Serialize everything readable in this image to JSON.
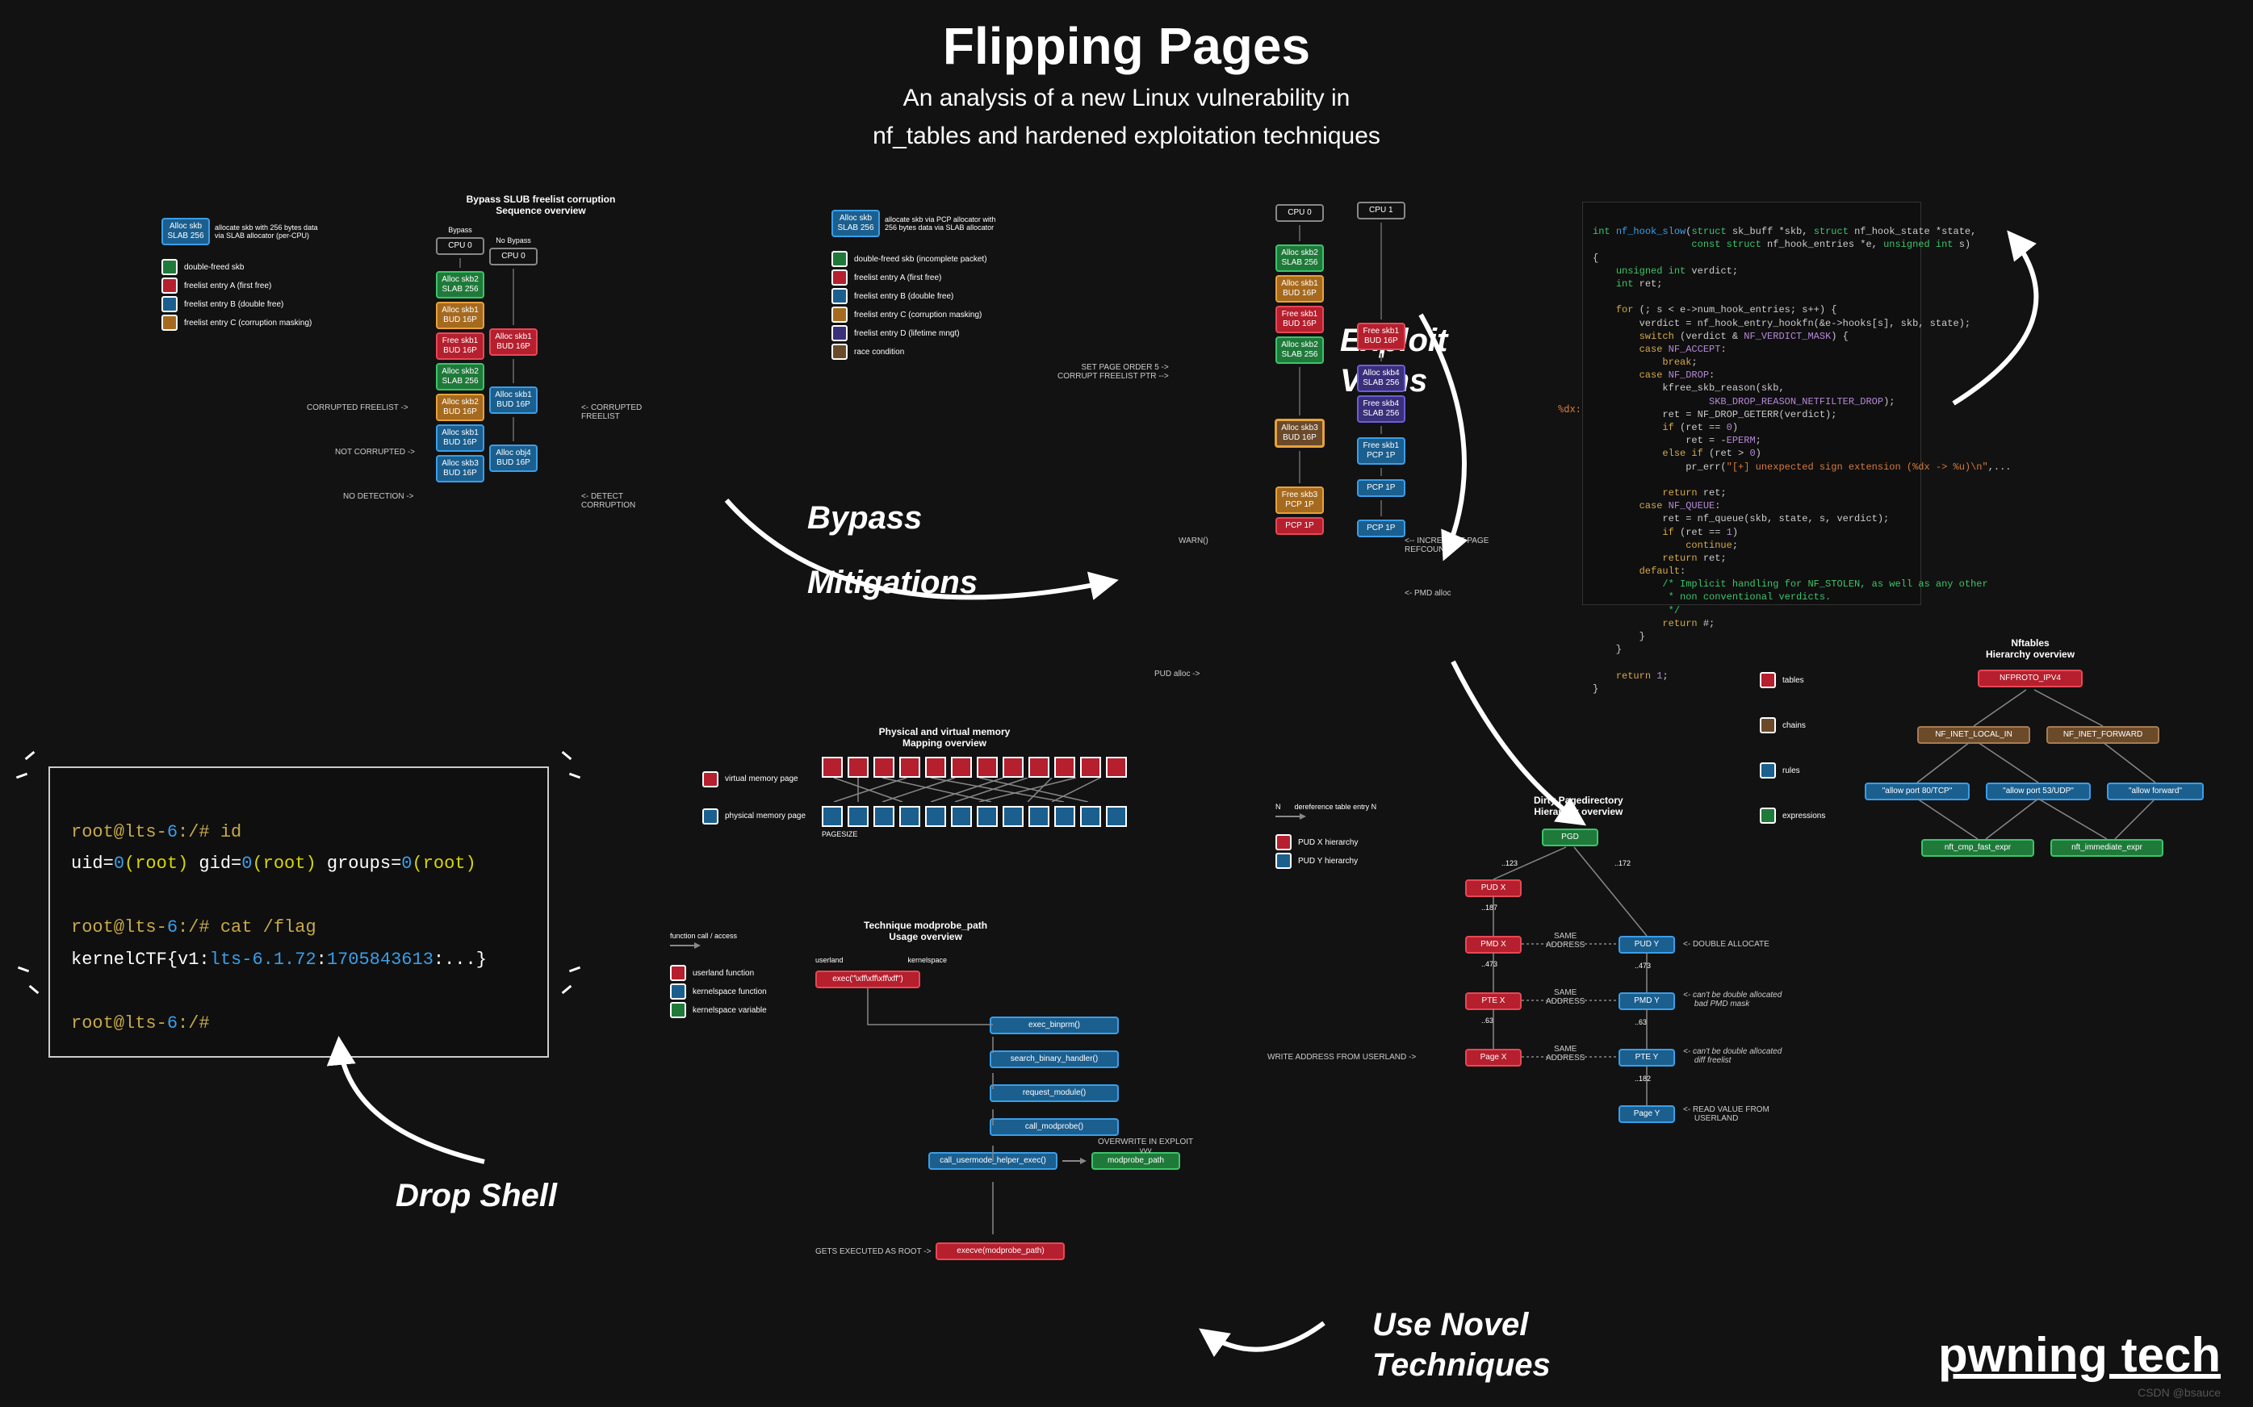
{
  "header": {
    "title": "Flipping Pages",
    "subtitle1": "An analysis of a new Linux vulnerability in",
    "subtitle2": "nf_tables and hardened exploitation techniques"
  },
  "brand": "pwning tech",
  "watermark": "CSDN @bsauce",
  "labels": {
    "bypass": "Bypass",
    "mitigations": "Mitigations",
    "exploit": "Exploit",
    "vulns": "Vulns",
    "use_novel": "Use Novel",
    "techniques": "Techniques",
    "drop_shell": "Drop Shell"
  },
  "terminal": {
    "l1a": "root@lts-",
    "l1b": "6",
    "l1c": ":/# id",
    "l2a": "uid=",
    "l2b": "0",
    "l2c": "(root)",
    "l2d": " gid=",
    "l2e": "0",
    "l2f": "(root)",
    "l2g": " groups=",
    "l2h": "0",
    "l2i": "(root)",
    "l3a": "root@lts-",
    "l3b": "6",
    "l3c": ":/# cat /flag",
    "l4a": "kernelCTF{v1:",
    "l4b": "lts-6.1.72",
    "l4c": ":",
    "l4d": "1705843613",
    "l4e": ":...}",
    "l5a": "root@lts-",
    "l5b": "6",
    "l5c": ":/#"
  },
  "panel1": {
    "title": "Bypass SLUB freelist corruption\nSequence overview",
    "alloc_box": "Alloc skb\nSLAB 256",
    "alloc_desc": "allocate skb with 256 bytes data\nvia SLAB allocator (per-CPU)",
    "leg_green": "double-freed skb",
    "leg_red": "freelist entry A  (first free)",
    "leg_blue": "freelist entry B (double free)",
    "leg_orange": "freelist entry C (corruption masking)",
    "hdr_bypass": "Bypass",
    "hdr_nobypass": "No Bypass",
    "cpu0": "CPU 0",
    "b1": "Alloc skb2\nSLAB 256",
    "b2": "Alloc skb1\nBUD 16P",
    "b3": "Free skb1\nBUD 16P",
    "b4": "Alloc skb2\nSLAB 256",
    "b5": "Alloc skb2\nBUD 16P",
    "b6": "Alloc skb1\nBUD 16P",
    "b7": "Alloc skb3\nBUD 16P",
    "n1": "Alloc skb1\nBUD 16P",
    "n2": "Alloc skb1\nBUD 16P",
    "n3": "Alloc obj4\nBUD 16P",
    "a1": "CORRUPTED FREELIST ->",
    "a2": "<- CORRUPTED FREELIST",
    "a3": "NOT CORRUPTED ->",
    "a4": "NO DETECTION ->",
    "a5": "<- DETECT CORRUPTION"
  },
  "panel2": {
    "alloc_box": "Alloc skb\nSLAB 256",
    "alloc_desc": "allocate skb via PCP allocator with\n256 bytes data via SLAB allocator",
    "leg_green": "double-freed skb (incomplete packet)",
    "leg_red": "freelist entry A  (first free)",
    "leg_blue": "freelist entry B (double free)",
    "leg_orange": "freelist entry C (corruption masking)",
    "leg_purple": "freelist entry D (lifetime mngt)",
    "leg_brown": "race condition"
  },
  "panel3": {
    "cpu0": "CPU 0",
    "cpu1": "CPU 1",
    "b1": "Alloc skb2\nSLAB 256",
    "b2": "Alloc skb1\nBUD 16P",
    "b3": "Free skb1\nBUD 16P",
    "c1": "Free skb1\nBUD 16P",
    "c2": "Alloc skb2\nSLAB 256",
    "d1": "Alloc skb4\nSLAB 256",
    "d2": "Free skb4\nSLAB 256",
    "e1": "Alloc skb3\nBUD 16P",
    "e2": "Free skb1\nPCP 1P",
    "f1": "Free skb3\nPCP 1P",
    "p1": "PCP 1P",
    "p2": "PCP 1P",
    "a1": "SET PAGE ORDER 5 ->\nCORRUPT FREELIST PTR -->",
    "a2": "WARN()",
    "a3": "<-- INCREMENT PAGE REFCOUNT",
    "a4": "<- PMD alloc",
    "a5": "PUD alloc ->"
  },
  "mapping": {
    "title1": "Physical and virtual memory",
    "title2": "Mapping overview",
    "leg_red": "virtual memory page",
    "leg_blue": "physical memory page",
    "pagesize": "PAGESIZE"
  },
  "modprobe": {
    "title1": "Technique modprobe_path",
    "title2": "Usage overview",
    "leg_title": "function call / access",
    "leg_red": "userland function",
    "leg_blue": "kernelspace function",
    "leg_green": "kernelspace variable",
    "col_user": "userland",
    "col_kernel": "kernelspace",
    "n_exec": "exec(\"\\xff\\xff\\xff\\xff\")",
    "n1": "exec_binprm()",
    "n2": "search_binary_handler()",
    "n3": "request_module()",
    "n4": "call_modprobe()",
    "n5": "call_usermode_helper_exec()",
    "n_var": "modprobe_path",
    "n_root": "execve(modprobe_path)",
    "a_over": "OVERWRITE IN EXPLOIT\nvvv",
    "a_root": "GETS EXECUTED AS ROOT ->"
  },
  "dirty": {
    "title1": "Dirty Pagedirectory",
    "title2": "Hierarchy overview",
    "leg_title": "dereference table entry N",
    "leg_n": "N",
    "leg_red": "PUD X hierarchy",
    "leg_blue": "PUD Y hierarchy",
    "pgd": "PGD",
    "pudx": "PUD X",
    "pudy": "PUD Y",
    "pmdx": "PMD X",
    "pmdy": "PMD Y",
    "ptex": "PTE X",
    "ptey": "PTE Y",
    "pagex": "Page X",
    "pagey": "Page Y",
    "e123": "..123",
    "e172": "..172",
    "e187": "..187",
    "e473a": "..473",
    "e473b": "..473",
    "e63a": "..63",
    "e63b": "..63",
    "e182": "..182",
    "same": "SAME\nADDRESS",
    "a1": "<- DOUBLE ALLOCATE",
    "a2": "<- can't be double allocated\n     bad PMD mask",
    "a3": "<- can't be double allocated\n     diff freelist",
    "a4": "WRITE ADDRESS FROM USERLAND ->",
    "a5": "<- READ VALUE FROM\n     USERLAND"
  },
  "nft": {
    "title1": "Nftables",
    "title2": "Hierarchy overview",
    "leg_red": "tables",
    "leg_brown": "chains",
    "leg_blue": "rules",
    "leg_green": "expressions",
    "root": "NFPROTO_IPV4",
    "c1": "NF_INET_LOCAL_IN",
    "c2": "NF_INET_FORWARD",
    "r1": "\"allow port 80/TCP\"",
    "r2": "\"allow port 53/UDP\"",
    "r3": "\"allow forward\"",
    "e1": "nft_cmp_fast_expr",
    "e2": "nft_immediate_expr"
  },
  "code": {
    "l1": "int nf_hook_slow(struct sk_buff *skb, struct nf_hook_state *state,",
    "l2": "                 const struct nf_hook_entries *e, unsigned int s)",
    "l3": "{",
    "l4": "    unsigned int verdict;",
    "l5": "    int ret;",
    "l6": "",
    "l7": "    for (; s < e->num_hook_entries; s++) {",
    "l8": "        verdict = nf_hook_entry_hookfn(&e->hooks[s], skb, state);",
    "l9": "        switch (verdict & NF_VERDICT_MASK) {",
    "l10": "        case NF_ACCEPT:",
    "l11": "            break;",
    "l12": "        case NF_DROP:",
    "l13": "            kfree_skb_reason(skb,",
    "l14": "                    SKB_DROP_REASON_NETFILTER_DROP);",
    "l15": "            ret = NF_DROP_GETERR(verdict);",
    "l16": "            if (ret == 0)",
    "l17": "                ret = -EPERM;",
    "l18": "            else if (ret > 0)",
    "l19": "                pr_err(\"[+] unexpected sign extension (%dx -> %u)\\n\",...",
    "l20": "",
    "l21": "            return ret;",
    "l22": "        case NF_QUEUE:",
    "l23": "            ret = nf_queue(skb, state, s, verdict);",
    "l24": "            if (ret == 1)",
    "l25": "                continue;",
    "l26": "            return ret;",
    "l27": "        default:",
    "l28": "            /* Implicit handling for NF_STOLEN, as well as any other",
    "l29": "             * non conventional verdicts.",
    "l30": "             */",
    "l31": "            return #;",
    "l32": "        }",
    "l33": "    }",
    "l34": "",
    "l35": "    return 1;",
    "l36": "}",
    "hint": "%dx:"
  }
}
